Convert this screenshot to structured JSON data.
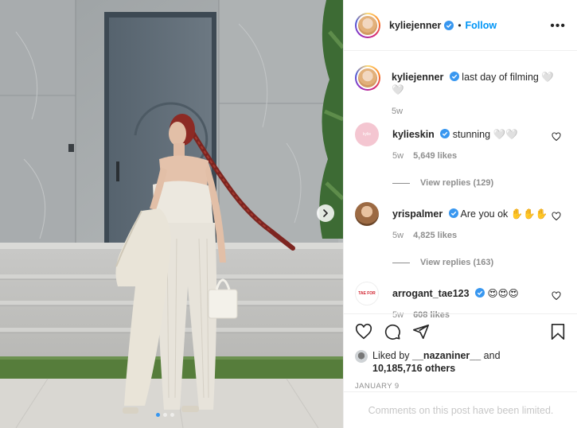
{
  "post": {
    "author": "kyliejenner",
    "follow_label": "Follow",
    "separator": "•",
    "more_label": "•••"
  },
  "caption": {
    "username": "kyliejenner",
    "text": "last day of filming 🤍🤍",
    "time": "5w"
  },
  "comments": [
    {
      "username": "kylieskin",
      "text": "stunning 🤍🤍",
      "time": "5w",
      "likes": "5,649 likes",
      "replies": "View replies (129)"
    },
    {
      "username": "yrispalmer",
      "text": "Are you ok ✋✋✋",
      "time": "5w",
      "likes": "4,825 likes",
      "replies": "View replies (163)"
    },
    {
      "username": "arrogant_tae123",
      "text": "😍😍😍",
      "time": "5w",
      "likes": "608 likes"
    }
  ],
  "likes": {
    "prefix": "Liked by ",
    "user": "__nazaniner__",
    "middle": " and",
    "count": "10,185,716 others"
  },
  "date": "JANUARY 9",
  "footer_text": "Comments on this post have been limited.",
  "avatar_badge_text": "TAE FOR",
  "colors": {
    "accent": "#0095f6",
    "verified": "#3897f0",
    "muted": "#8e8e8e"
  },
  "icons": [
    "verified-icon",
    "heart-icon",
    "comment-icon",
    "share-icon",
    "bookmark-icon",
    "chevron-right-icon"
  ]
}
